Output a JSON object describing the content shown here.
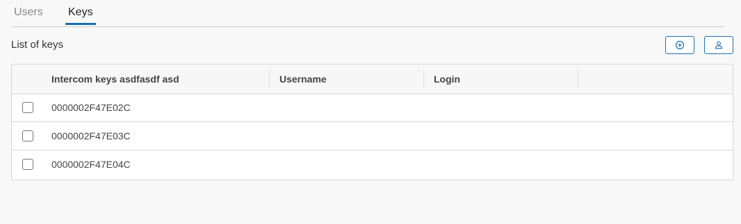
{
  "tabs": [
    {
      "label": "Users",
      "active": false
    },
    {
      "label": "Keys",
      "active": true
    }
  ],
  "section": {
    "title": "List of keys"
  },
  "toolbar": {
    "add_icon": "add-circle-icon",
    "user_icon": "user-icon"
  },
  "table": {
    "columns": [
      "Intercom keys asdfasdf asd",
      "Username",
      "Login"
    ],
    "rows": [
      {
        "key": "0000002F47E02C",
        "username": "",
        "login": "",
        "checked": false
      },
      {
        "key": "0000002F47E03C",
        "username": "",
        "login": "",
        "checked": false
      },
      {
        "key": "0000002F47E04C",
        "username": "",
        "login": "",
        "checked": false
      }
    ]
  },
  "colors": {
    "accent": "#1a6fae",
    "background": "#f8f8f8",
    "border": "#d6d6d6"
  }
}
